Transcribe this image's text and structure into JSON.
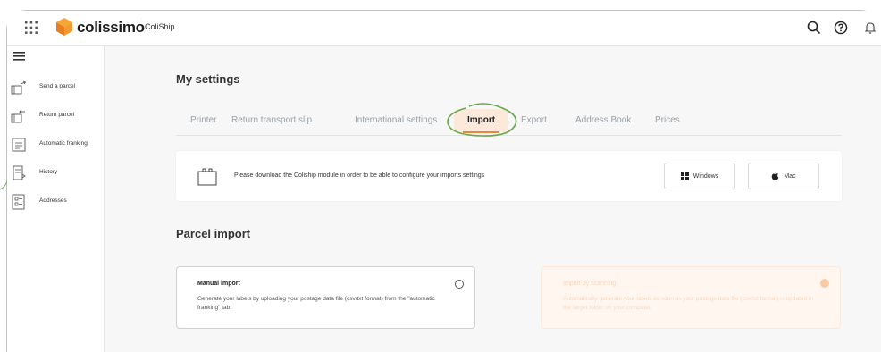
{
  "header": {
    "brand": "colissimo",
    "app_name": "ColiShip",
    "icons": [
      "apps-grid-icon",
      "colissimo-box-logo",
      "search-icon",
      "help-icon",
      "notifications-icon"
    ]
  },
  "sidebar": {
    "items": [
      {
        "label": "Send a parcel",
        "icon": "send-parcel-icon"
      },
      {
        "label": "Return parcel",
        "icon": "return-parcel-icon"
      },
      {
        "label": "Automatic franking",
        "icon": "automatic-franking-icon"
      },
      {
        "label": "History",
        "icon": "history-icon"
      },
      {
        "label": "Addresses",
        "icon": "addresses-icon"
      }
    ]
  },
  "main": {
    "title": "My settings",
    "tabs": [
      {
        "label": "Printer"
      },
      {
        "label": "Return transport slip"
      },
      {
        "label": "International settings"
      },
      {
        "label": "Import",
        "active": true
      },
      {
        "label": "Export"
      },
      {
        "label": "Address Book"
      },
      {
        "label": "Prices"
      }
    ],
    "notice": {
      "text": "Please download the Coliship module in order to be able to configure your imports settings",
      "windows_label": "Windows",
      "mac_label": "Mac"
    },
    "parcel_import": {
      "title": "Parcel import",
      "options": [
        {
          "title": "Manual import",
          "description": "Generate your labels by uploading your postage data file (csv/txt format) from the \"automatic franking\" tab."
        },
        {
          "title": "Import by scanning",
          "description": "Automatically generate your labels as soon as your postage data file (csv/txt format) is updated in the target folder on your computer."
        }
      ]
    }
  },
  "colors": {
    "accent_orange": "#e9883b",
    "highlight_green": "#6aa84f",
    "active_tab_bg": "#fce9da"
  }
}
